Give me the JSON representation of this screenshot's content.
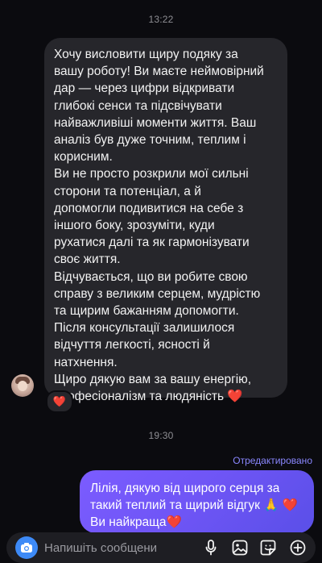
{
  "thread": {
    "timestamp_1": "13:22",
    "timestamp_2": "19:30"
  },
  "incoming_message": {
    "paragraphs": [
      "Хочу висловити щиру подяку за\nвашу роботу! Ви маєте неймовірний\nдар — через цифри відкривати\nглибокі сенси та підсвічувати\nнайважливіші моменти життя. Ваш\nаналіз був дуже точним, теплим і\nкорисним.",
      "Ви не просто розкрили мої сильні\nсторони та потенціал, а й\nдопомогли подивитися на себе з\nіншого боку, зрозуміти, куди\nрухатися далі та як гармонізувати\nсвоє життя.",
      "Відчувається, що ви робите свою\nсправу з великим серцем, мудрістю\nта щирим бажанням допомогти.\nПісля консультації залишилося\nвідчуття легкості, ясності й\nнатхнення.",
      "Щиро дякую вам за вашу енергію,\nпрофесіоналізм та людяність ❤️"
    ],
    "reaction": "❤️"
  },
  "outgoing_message": {
    "edited_label": "Отредактировано",
    "text": "Лілія, дякую від щирого серця за\nтакий теплий та щирий відгук 🙏 ❤️\nВи найкраща❤️"
  },
  "composer": {
    "placeholder": "Напишіть сообщение..."
  },
  "colors": {
    "background": "#0b0b0f",
    "incoming_bubble": "#26262b",
    "outgoing_gradient_start": "#7b5cff",
    "outgoing_gradient_end": "#5a4fe8",
    "edited_label": "#8a87ff",
    "camera_button": "#3d8af7",
    "heart": "#ff3b4a"
  },
  "icons": {
    "camera": "camera-icon",
    "mic": "microphone-icon",
    "gallery": "gallery-icon",
    "sticker": "sticker-icon",
    "plus": "plus-icon"
  }
}
